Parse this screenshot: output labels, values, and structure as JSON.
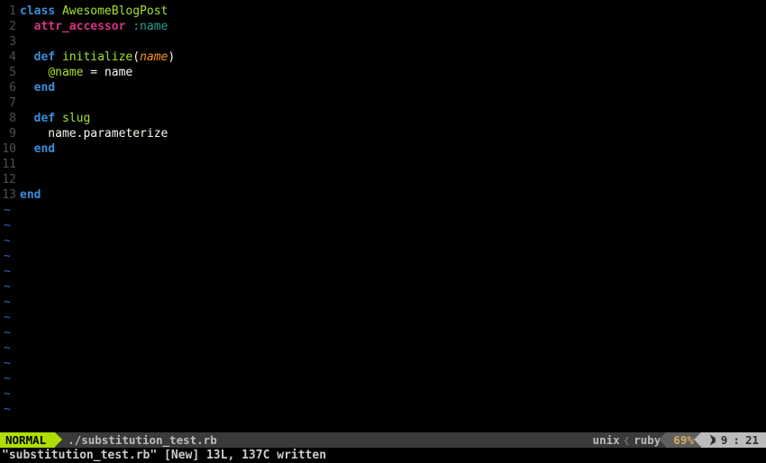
{
  "code": {
    "lines": [
      {
        "n": "1",
        "tokens": [
          [
            "kw",
            "class "
          ],
          [
            "cls",
            "AwesomeBlogPost"
          ]
        ]
      },
      {
        "n": "2",
        "tokens": [
          [
            "plain",
            "  "
          ],
          [
            "attr",
            "attr_accessor"
          ],
          [
            "plain",
            " "
          ],
          [
            "sym",
            ":name"
          ]
        ]
      },
      {
        "n": "3",
        "tokens": []
      },
      {
        "n": "4",
        "tokens": [
          [
            "plain",
            "  "
          ],
          [
            "kw",
            "def "
          ],
          [
            "func",
            "initialize"
          ],
          [
            "plain",
            "("
          ],
          [
            "param",
            "name"
          ],
          [
            "plain",
            ")"
          ]
        ]
      },
      {
        "n": "5",
        "tokens": [
          [
            "plain",
            "    "
          ],
          [
            "ivar",
            "@name"
          ],
          [
            "plain",
            " = name"
          ]
        ]
      },
      {
        "n": "6",
        "tokens": [
          [
            "plain",
            "  "
          ],
          [
            "kw",
            "end"
          ]
        ]
      },
      {
        "n": "7",
        "tokens": []
      },
      {
        "n": "8",
        "tokens": [
          [
            "plain",
            "  "
          ],
          [
            "kw",
            "def "
          ],
          [
            "func",
            "slug"
          ]
        ]
      },
      {
        "n": "9",
        "tokens": [
          [
            "plain",
            "    name.parameterize"
          ]
        ]
      },
      {
        "n": "10",
        "tokens": [
          [
            "plain",
            "  "
          ],
          [
            "kw",
            "end"
          ]
        ]
      },
      {
        "n": "11",
        "tokens": []
      },
      {
        "n": "12",
        "tokens": []
      },
      {
        "n": "13",
        "tokens": [
          [
            "kw",
            "end"
          ]
        ]
      }
    ],
    "tilde_count": 14
  },
  "status": {
    "mode": "NORMAL",
    "file_path": "./substitution_test.rb",
    "file_format": "unix",
    "file_type": "ruby",
    "percent": "69%",
    "line": "9",
    "col": "21"
  },
  "command": {
    "filename": "\"substitution_test.rb\"",
    "message": "[New] 13L, 137C written"
  }
}
